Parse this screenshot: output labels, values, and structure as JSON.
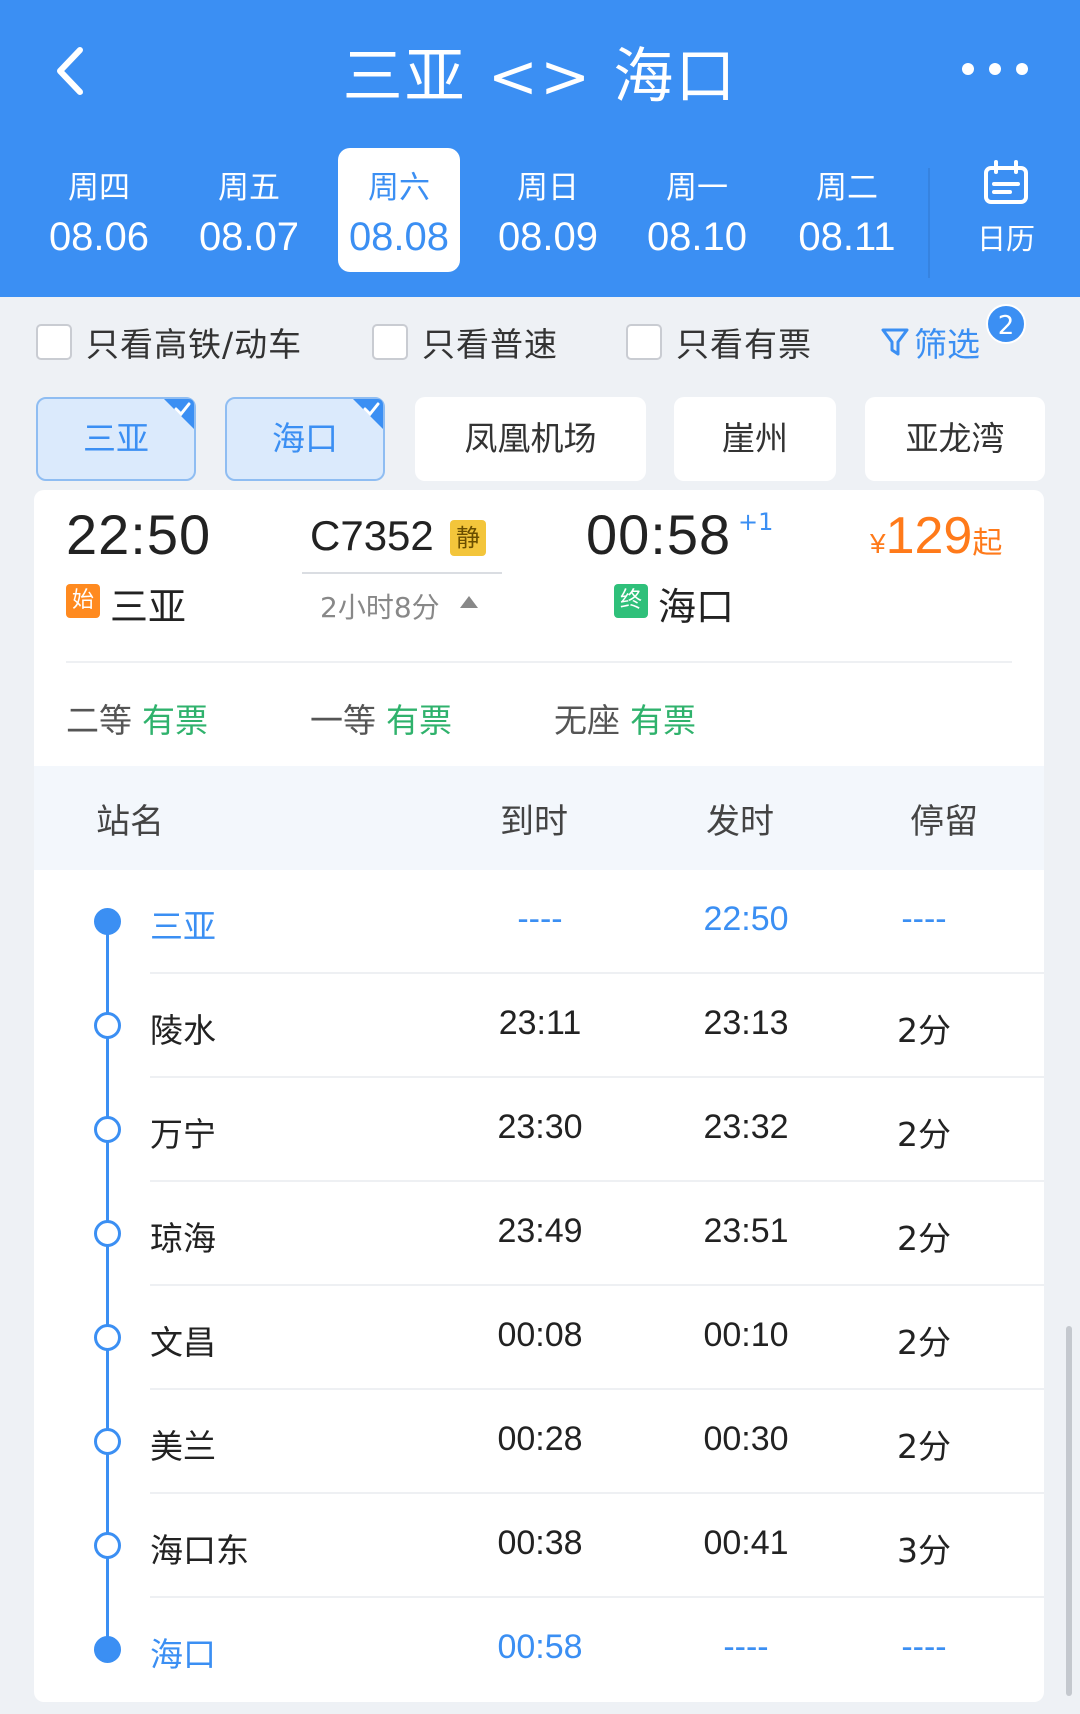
{
  "header": {
    "title": "三亚 <> 海口"
  },
  "dates": [
    {
      "weekday": "周四",
      "date": "08.06"
    },
    {
      "weekday": "周五",
      "date": "08.07"
    },
    {
      "weekday": "周六",
      "date": "08.08"
    },
    {
      "weekday": "周日",
      "date": "08.09"
    },
    {
      "weekday": "周一",
      "date": "08.10"
    },
    {
      "weekday": "周二",
      "date": "08.11"
    }
  ],
  "calendar_label": "日历",
  "filters": {
    "high_speed": "只看高铁/动车",
    "normal": "只看普速",
    "available": "只看有票",
    "screen": "筛选",
    "screen_count": "2"
  },
  "station_filters": [
    "三亚",
    "海口",
    "凤凰机场",
    "崖州",
    "亚龙湾"
  ],
  "train": {
    "dep_time": "22:50",
    "train_no": "C7352",
    "quiet_tag": "静",
    "duration": "2小时8分",
    "arr_time": "00:58",
    "day_offset": "+1",
    "price_currency": "¥",
    "price": "129",
    "price_suffix": "起",
    "start_tag": "始",
    "end_tag": "终",
    "from": "三亚",
    "to": "海口",
    "seats": [
      {
        "class": "二等",
        "status": "有票"
      },
      {
        "class": "一等",
        "status": "有票"
      },
      {
        "class": "无座",
        "status": "有票"
      }
    ]
  },
  "table": {
    "headers": {
      "name": "站名",
      "arrive": "到时",
      "depart": "发时",
      "stay": "停留"
    },
    "rows": [
      {
        "name": "三亚",
        "arrive": "----",
        "depart": "22:50",
        "stay": "----"
      },
      {
        "name": "陵水",
        "arrive": "23:11",
        "depart": "23:13",
        "stay": "2分"
      },
      {
        "name": "万宁",
        "arrive": "23:30",
        "depart": "23:32",
        "stay": "2分"
      },
      {
        "name": "琼海",
        "arrive": "23:49",
        "depart": "23:51",
        "stay": "2分"
      },
      {
        "name": "文昌",
        "arrive": "00:08",
        "depart": "00:10",
        "stay": "2分"
      },
      {
        "name": "美兰",
        "arrive": "00:28",
        "depart": "00:30",
        "stay": "2分"
      },
      {
        "name": "海口东",
        "arrive": "00:38",
        "depart": "00:41",
        "stay": "3分"
      },
      {
        "name": "海口",
        "arrive": "00:58",
        "depart": "----",
        "stay": "----"
      }
    ]
  },
  "colors": {
    "primary": "#3b8ff3",
    "price": "#ff7a1a",
    "available": "#2fb26c",
    "start_tag": "#ff8a1f",
    "end_tag": "#2fc07a"
  }
}
